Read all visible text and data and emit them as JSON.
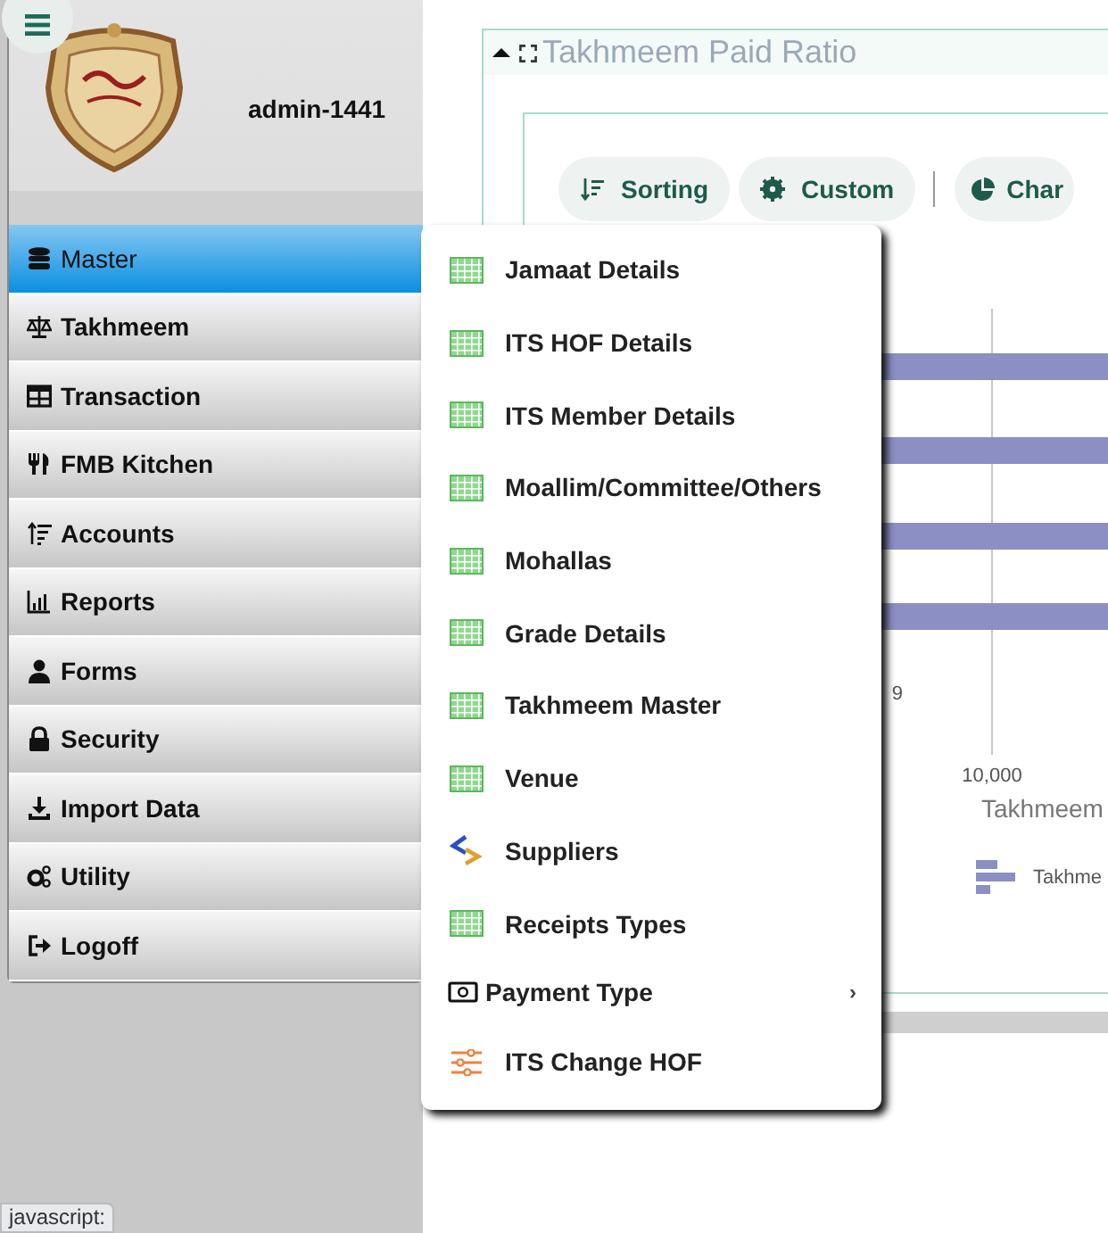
{
  "header": {
    "username": "admin-1441"
  },
  "sidebar": {
    "items": [
      {
        "label": "Master",
        "selected": true
      },
      {
        "label": "Takhmeem",
        "selected": false
      },
      {
        "label": "Transaction",
        "selected": false
      },
      {
        "label": "FMB Kitchen",
        "selected": false
      },
      {
        "label": "Accounts",
        "selected": false
      },
      {
        "label": "Reports",
        "selected": false
      },
      {
        "label": "Forms",
        "selected": false
      },
      {
        "label": "Security",
        "selected": false
      },
      {
        "label": "Import Data",
        "selected": false
      },
      {
        "label": "Utility",
        "selected": false
      },
      {
        "label": "Logoff",
        "selected": false
      }
    ]
  },
  "submenu": {
    "items": [
      {
        "label": "Jamaat Details"
      },
      {
        "label": "ITS HOF Details"
      },
      {
        "label": "ITS Member Details"
      },
      {
        "label": "Moallim/Committee/Others"
      },
      {
        "label": "Mohallas"
      },
      {
        "label": "Grade Details"
      },
      {
        "label": "Takhmeem Master"
      },
      {
        "label": "Venue"
      },
      {
        "label": "Suppliers"
      },
      {
        "label": "Receipts Types"
      },
      {
        "label": "Payment Type",
        "arrow": "›"
      },
      {
        "label": "ITS Change HOF"
      }
    ]
  },
  "panel": {
    "title": "Takhmeem Paid Ratio",
    "expanded": true,
    "toolbar": [
      {
        "label": "Sorting"
      },
      {
        "label": "Custom"
      },
      {
        "label": "Char"
      }
    ],
    "chart": {
      "cut_label": "9",
      "tick": "10,000",
      "axis_title": "Takhmeem",
      "legend": "Takhme"
    }
  },
  "status_bar": {
    "text": "javascript:"
  }
}
